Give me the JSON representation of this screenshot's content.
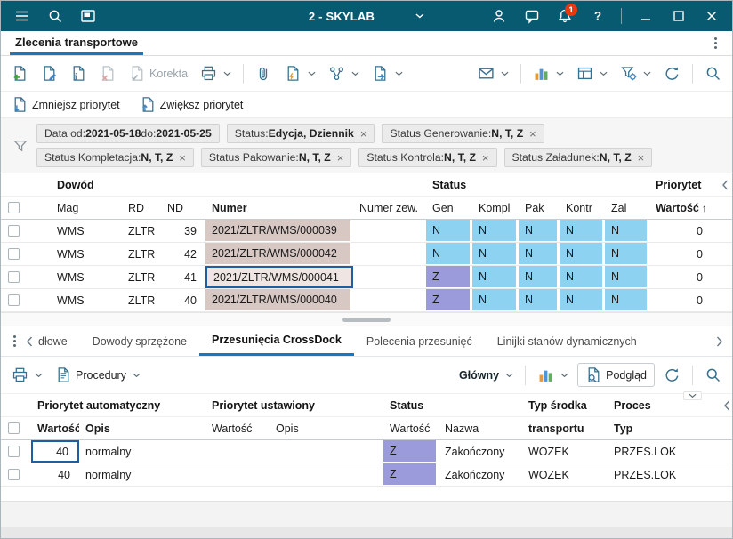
{
  "colors": {
    "titlebar_bg": "#085a70",
    "accent_blue": "#1877c2",
    "icon_color": "#35708e",
    "status_n_bg": "#8ed2f2",
    "status_z_bg": "#9b9bdb",
    "numer_cell_bg": "#d7c8c4",
    "selection_border": "#1d5fa0",
    "badge_red": "#e8380d"
  },
  "icons": {
    "hamburger-icon": "three-lines",
    "search-icon": "magnifier",
    "app-window-icon": "window",
    "user-icon": "person",
    "chat-icon": "speech-bubble",
    "bell-icon": "bell",
    "help-icon": "question-mark",
    "minimize-icon": "dash",
    "maximize-icon": "square",
    "close-icon": "x",
    "add-document-icon": "doc-plus-green",
    "edit-document-icon": "doc-pencil",
    "document-info-icon": "doc-i",
    "delete-document-icon": "doc-x-gray",
    "korekta-icon": "doc-check-gray",
    "printer-icon": "printer",
    "paperclip-icon": "paperclip",
    "generate-document-icon": "doc-bolt",
    "relations-icon": "linked-nodes",
    "export-document-icon": "doc-arrow",
    "send-icon": "envelope",
    "analysis-icon": "bar-chart-color",
    "view-icon": "table-layout",
    "filter-settings-icon": "funnel-gear",
    "refresh-icon": "circular-arrow",
    "filter-icon": "funnel",
    "decrease-priority-icon": "doc-arrow-down",
    "increase-priority-icon": "doc-arrow-up",
    "procedury-icon": "doc-lines",
    "podglad-icon": "doc-magnifier",
    "kebab-menu-icon": "vertical-dots",
    "chevron-down-icon": "chevron-down",
    "chevron-left-icon": "chevron-left",
    "chevron-right-icon": "chevron-right",
    "sort-ascending-icon": "up-arrow",
    "chip-close-icon": "x"
  },
  "titlebar": {
    "title": "2 - SKYLAB",
    "notification_count": "1"
  },
  "page_tab": {
    "label": "Zlecenia transportowe"
  },
  "toolbar": {
    "korekta_label": "Korekta"
  },
  "priority_toolbar": {
    "decrease_label": "Zmniejsz priorytet",
    "increase_label": "Zwiększ priorytet"
  },
  "filters": {
    "rows": [
      [
        {
          "segments": [
            {
              "text": "Data  od: ",
              "bold": false
            },
            {
              "text": "2021-05-18",
              "bold": true
            },
            {
              "text": "  do: ",
              "bold": false
            },
            {
              "text": "2021-05-25",
              "bold": true
            }
          ],
          "closable": false
        },
        {
          "segments": [
            {
              "text": "Status: ",
              "bold": false
            },
            {
              "text": "Edycja, Dziennik",
              "bold": true
            }
          ],
          "closable": true
        },
        {
          "segments": [
            {
              "text": "Status  Generowanie: ",
              "bold": false
            },
            {
              "text": "N, T, Z",
              "bold": true
            }
          ],
          "closable": true
        }
      ],
      [
        {
          "segments": [
            {
              "text": "Status  Kompletacja: ",
              "bold": false
            },
            {
              "text": "N, T, Z",
              "bold": true
            }
          ],
          "closable": true
        },
        {
          "segments": [
            {
              "text": "Status  Pakowanie: ",
              "bold": false
            },
            {
              "text": "N, T, Z",
              "bold": true
            }
          ],
          "closable": true
        },
        {
          "segments": [
            {
              "text": "Status  Kontrola: ",
              "bold": false
            },
            {
              "text": "N, T, Z",
              "bold": true
            }
          ],
          "closable": true
        },
        {
          "segments": [
            {
              "text": "Status  Załadunek: ",
              "bold": false
            },
            {
              "text": "N, T, Z",
              "bold": true
            }
          ],
          "closable": true
        }
      ]
    ]
  },
  "main_table": {
    "group_headers": [
      "Dowód",
      "Status",
      "Priorytet"
    ],
    "columns": [
      "Mag",
      "RD",
      "ND",
      "Numer",
      "Numer zew.",
      "Gen",
      "Kompl",
      "Pak",
      "Kontr",
      "Zal",
      "Wartość"
    ],
    "sort_indicator": "↑",
    "rows": [
      {
        "cells": [
          "WMS",
          "ZLTR",
          "39",
          "2021/ZLTR/WMS/000039",
          "",
          "N",
          "N",
          "N",
          "N",
          "N",
          "0"
        ],
        "selected": false
      },
      {
        "cells": [
          "WMS",
          "ZLTR",
          "42",
          "2021/ZLTR/WMS/000042",
          "",
          "N",
          "N",
          "N",
          "N",
          "N",
          "0"
        ],
        "selected": false
      },
      {
        "cells": [
          "WMS",
          "ZLTR",
          "41",
          "2021/ZLTR/WMS/000041",
          "",
          "Z",
          "N",
          "N",
          "N",
          "N",
          "0"
        ],
        "selected": true
      },
      {
        "cells": [
          "WMS",
          "ZLTR",
          "40",
          "2021/ZLTR/WMS/000040",
          "",
          "Z",
          "N",
          "N",
          "N",
          "N",
          "0"
        ],
        "selected": false
      }
    ]
  },
  "bottom_tabs": {
    "tabs": [
      "dłowe",
      "Dowody sprzężone",
      "Przesunięcia CrossDock",
      "Polecenia przesunięć",
      "Linijki stanów dynamicznych"
    ],
    "active": "Przesunięcia CrossDock"
  },
  "bottom_toolbar": {
    "procedury_label": "Procedury",
    "view_selector": "Główny",
    "podglad_label": "Podgląd"
  },
  "bottom_table": {
    "group_headers": [
      "Priorytet automatyczny",
      "Priorytet ustawiony",
      "Status",
      "Typ środka",
      "Proces"
    ],
    "columns": [
      "Wartość",
      "Opis",
      "Wartość",
      "Opis",
      "Wartość",
      "Nazwa",
      "transportu",
      "Typ"
    ],
    "sort_indicator": "↑",
    "rows": [
      {
        "cells": [
          "40",
          "normalny",
          "",
          "",
          "Z",
          "Zakończony",
          "WOZEK",
          "PRZES.LOK"
        ],
        "selected": true
      },
      {
        "cells": [
          "40",
          "normalny",
          "",
          "",
          "Z",
          "Zakończony",
          "WOZEK",
          "PRZES.LOK"
        ],
        "selected": false
      }
    ]
  }
}
